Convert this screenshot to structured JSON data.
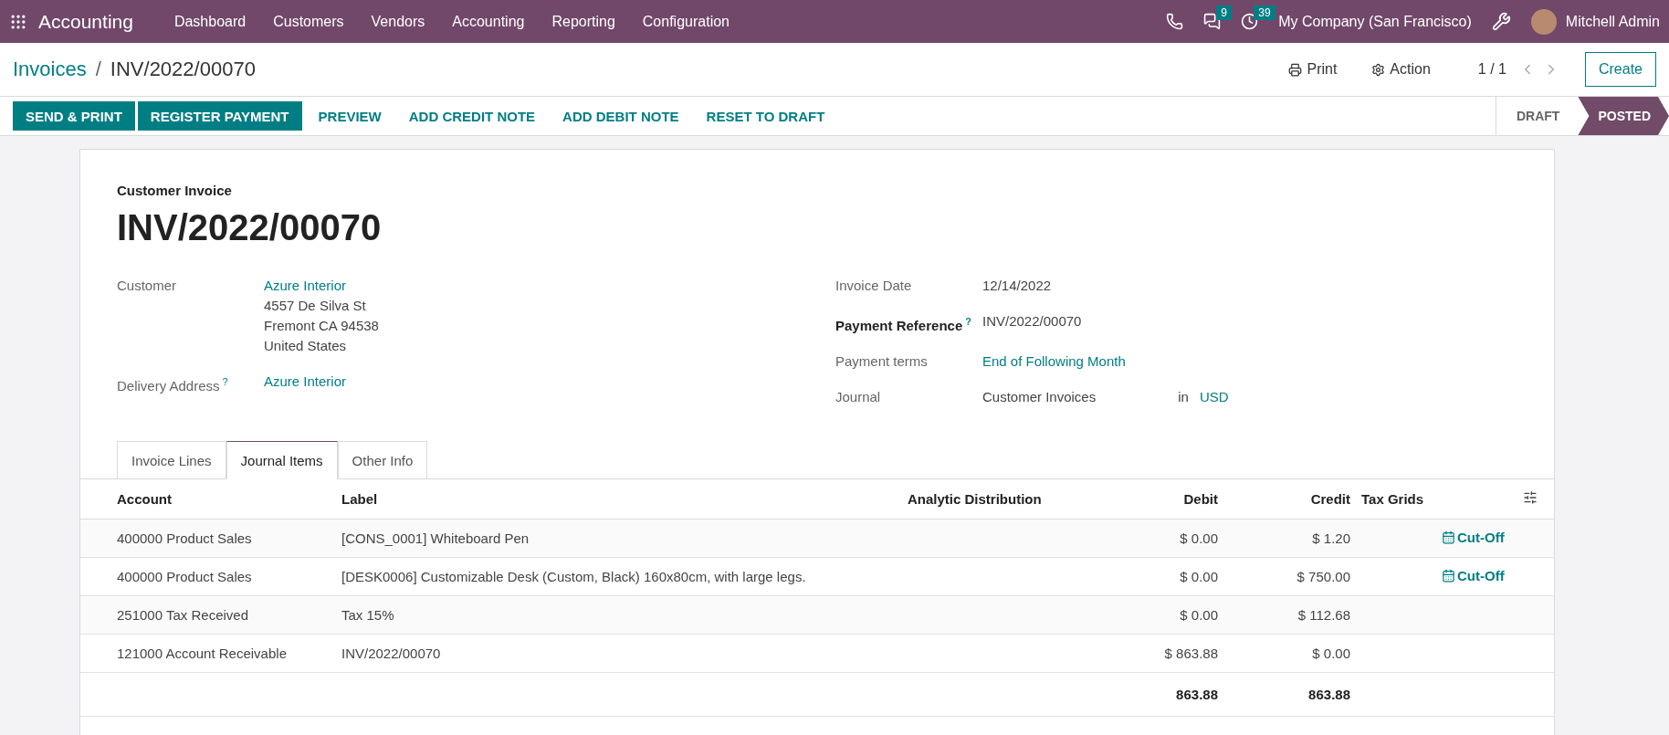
{
  "navbar": {
    "app_name": "Accounting",
    "menu": [
      "Dashboard",
      "Customers",
      "Vendors",
      "Accounting",
      "Reporting",
      "Configuration"
    ],
    "messages_count": "9",
    "activities_count": "39",
    "company": "My Company (San Francisco)",
    "user": "Mitchell Admin"
  },
  "breadcrumb": {
    "parent": "Invoices",
    "separator": "/",
    "current": "INV/2022/00070"
  },
  "actions": {
    "print": "Print",
    "action": "Action",
    "pager": "1 / 1",
    "create": "Create"
  },
  "buttons": [
    {
      "label": "SEND & PRINT",
      "kind": "primary"
    },
    {
      "label": "REGISTER PAYMENT",
      "kind": "primary"
    },
    {
      "label": "PREVIEW",
      "kind": "link"
    },
    {
      "label": "ADD CREDIT NOTE",
      "kind": "link"
    },
    {
      "label": "ADD DEBIT NOTE",
      "kind": "link"
    },
    {
      "label": "RESET TO DRAFT",
      "kind": "link"
    }
  ],
  "statuses": [
    {
      "label": "DRAFT",
      "selected": false
    },
    {
      "label": "POSTED",
      "selected": true
    }
  ],
  "form": {
    "type": "Customer Invoice",
    "name": "INV/2022/00070",
    "left_fields": [
      {
        "label": "Customer",
        "value": "Azure Interior",
        "kind": "link",
        "extra_lines": [
          "4557 De Silva St",
          "Fremont CA 94538",
          "United States"
        ]
      },
      {
        "label": "Delivery Address",
        "help": "?",
        "value": "Azure Interior",
        "kind": "link"
      }
    ],
    "right_fields": [
      {
        "label": "Invoice Date",
        "value": "12/14/2022",
        "kind": "text"
      },
      {
        "label": "Payment Reference",
        "help": "?",
        "bold": true,
        "value": "INV/2022/00070",
        "kind": "text"
      },
      {
        "label": "Payment terms",
        "value": "End of Following Month",
        "kind": "link"
      },
      {
        "label": "Journal",
        "value": "Customer Invoices",
        "kind": "currency",
        "joiner": "in",
        "currency": "USD"
      }
    ]
  },
  "tabs": [
    {
      "label": "Invoice Lines",
      "selected": false
    },
    {
      "label": "Journal Items",
      "selected": true
    },
    {
      "label": "Other Info",
      "selected": false
    }
  ],
  "table": {
    "columns": [
      "Account",
      "Label",
      "Analytic Distribution",
      "Debit",
      "Credit",
      "Tax Grids"
    ],
    "rows": [
      {
        "account": "400000 Product Sales",
        "label": "[CONS_0001] Whiteboard Pen",
        "debit": "$ 0.00",
        "credit": "$ 1.20",
        "cutoff": "Cut-Off"
      },
      {
        "account": "400000 Product Sales",
        "label": "[DESK0006] Customizable Desk (Custom, Black) 160x80cm, with large legs.",
        "debit": "$ 0.00",
        "credit": "$ 750.00",
        "cutoff": "Cut-Off"
      },
      {
        "account": "251000 Tax Received",
        "label": "Tax 15%",
        "debit": "$ 0.00",
        "credit": "$ 112.68"
      },
      {
        "account": "121000 Account Receivable",
        "label": "INV/2022/00070",
        "debit": "$ 863.88",
        "credit": "$ 0.00"
      }
    ],
    "totals": {
      "debit": "863.88",
      "credit": "863.88"
    }
  }
}
